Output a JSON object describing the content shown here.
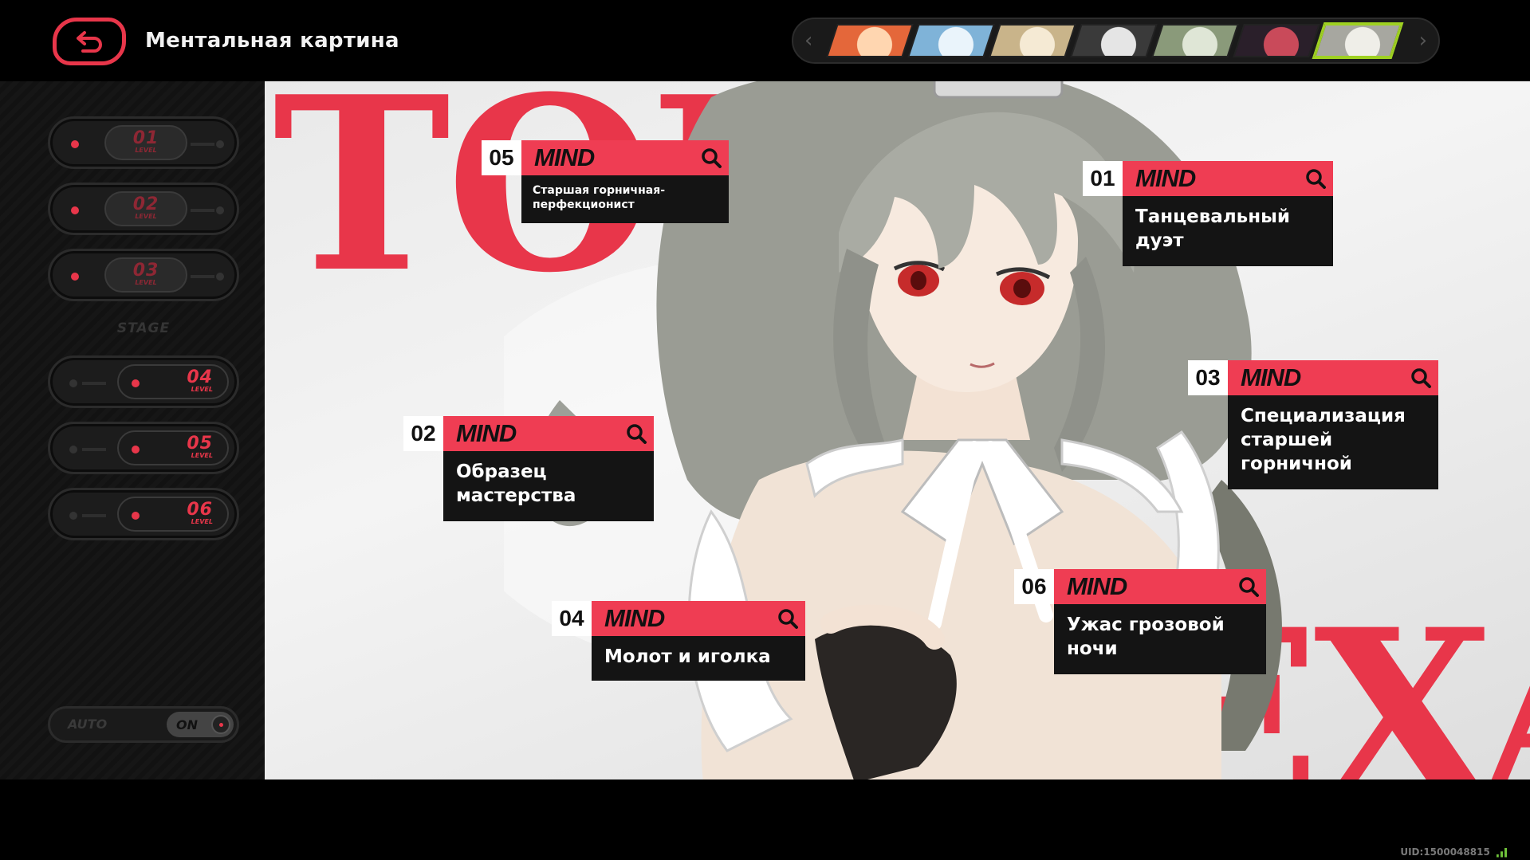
{
  "header": {
    "title": "Ментальная картина"
  },
  "agent_strip": {
    "agents": [
      {
        "icon": "agent-portrait-orange-hair",
        "color": "#e4673a",
        "accent": "#ffd6b0"
      },
      {
        "icon": "agent-portrait-blue-hair",
        "color": "#7fb3d8",
        "accent": "#eaf4fb"
      },
      {
        "icon": "agent-portrait-blonde-hair",
        "color": "#c9b48a",
        "accent": "#f5ead4"
      },
      {
        "icon": "agent-portrait-panda",
        "color": "#3a3a3a",
        "accent": "#e5e5e5"
      },
      {
        "icon": "agent-portrait-green-hair",
        "color": "#8a9a7a",
        "accent": "#dfe6d6"
      },
      {
        "icon": "agent-portrait-dark-hair",
        "color": "#2a1f2a",
        "accent": "#c94a5a"
      },
      {
        "icon": "agent-portrait-silver-hair",
        "color": "#a7a7a0",
        "accent": "#efeee8"
      }
    ],
    "active_index": 6,
    "active_color": "#9fd122"
  },
  "sidebar": {
    "levels": [
      {
        "num": "01",
        "sub": "LEVEL"
      },
      {
        "num": "02",
        "sub": "LEVEL"
      },
      {
        "num": "03",
        "sub": "LEVEL"
      },
      {
        "num": "04",
        "sub": "LEVEL"
      },
      {
        "num": "05",
        "sub": "LEVEL"
      },
      {
        "num": "06",
        "sub": "LEVEL"
      }
    ],
    "stage_label": "STAGE",
    "auto_label": "AUTO",
    "auto_state": "ON"
  },
  "stage": {
    "big_word_top": "TOIA",
    "big_word_bottom": "ALEXA",
    "accent": "#e8364a"
  },
  "mind_cards": [
    {
      "num": "05",
      "label": "MIND",
      "title": "Старшая горничная-перфекционист"
    },
    {
      "num": "01",
      "label": "MIND",
      "title": "Танцевальный дуэт"
    },
    {
      "num": "03",
      "label": "MIND",
      "title": "Специализация старшей горничной"
    },
    {
      "num": "02",
      "label": "MIND",
      "title": "Образец мастерства"
    },
    {
      "num": "04",
      "label": "MIND",
      "title": "Молот и иголка"
    },
    {
      "num": "06",
      "label": "MIND",
      "title": "Ужас грозовой ночи"
    }
  ],
  "footer": {
    "uid": "UID:1500048815"
  }
}
